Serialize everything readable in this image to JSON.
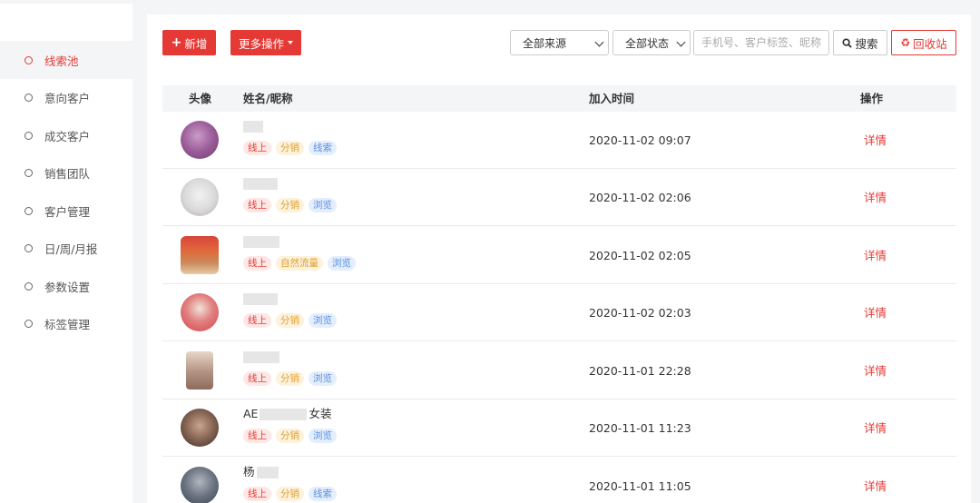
{
  "sidebar": {
    "items": [
      {
        "label": "线索池",
        "active": true
      },
      {
        "label": "意向客户",
        "active": false
      },
      {
        "label": "成交客户",
        "active": false
      },
      {
        "label": "销售团队",
        "active": false
      },
      {
        "label": "客户管理",
        "active": false
      },
      {
        "label": "日/周/月报",
        "active": false
      },
      {
        "label": "参数设置",
        "active": false
      },
      {
        "label": "标签管理",
        "active": false
      }
    ]
  },
  "toolbar": {
    "add_label": "新增",
    "more_label": "更多操作",
    "source_select": "全部来源",
    "status_select": "全部状态",
    "search_placeholder": "手机号、客户标签、昵称、",
    "search_label": "搜索",
    "recycle_label": "回收站"
  },
  "table": {
    "headers": {
      "avatar": "头像",
      "name": "姓名/昵称",
      "time": "加入时间",
      "op": "操作"
    },
    "rows": [
      {
        "name_visible": "",
        "tags": [
          "线上",
          "分销",
          "线索"
        ],
        "time": "2020-11-02 09:07",
        "action": "详情"
      },
      {
        "name_visible": "",
        "tags": [
          "线上",
          "分销",
          "浏览"
        ],
        "time": "2020-11-02 02:06",
        "action": "详情"
      },
      {
        "name_visible": "",
        "tags": [
          "线上",
          "自然流量",
          "浏览"
        ],
        "time": "2020-11-02 02:05",
        "action": "详情"
      },
      {
        "name_visible": "",
        "tags": [
          "线上",
          "分销",
          "浏览"
        ],
        "time": "2020-11-02 02:03",
        "action": "详情"
      },
      {
        "name_visible": "",
        "tags": [
          "线上",
          "分销",
          "浏览"
        ],
        "time": "2020-11-01 22:28",
        "action": "详情"
      },
      {
        "name_visible": "AE",
        "name_suffix": "女装",
        "tags": [
          "线上",
          "分销",
          "浏览"
        ],
        "time": "2020-11-01 11:23",
        "action": "详情"
      },
      {
        "name_visible": "杨",
        "tags": [
          "线上",
          "分销",
          "线索"
        ],
        "time": "2020-11-01 11:05",
        "action": "详情"
      }
    ]
  },
  "colors": {
    "accent": "#e53935",
    "tag_blue": "#5a8fe0",
    "tag_orange": "#e0a030"
  }
}
